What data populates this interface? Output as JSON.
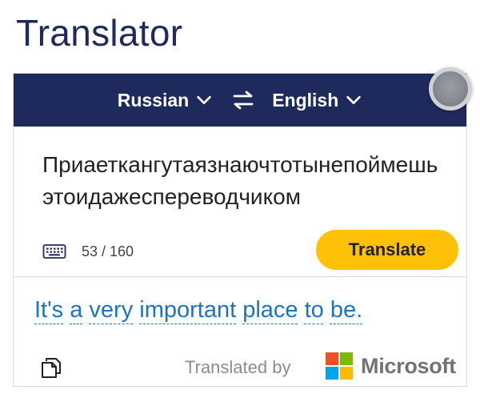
{
  "header": {
    "title": "Translator"
  },
  "languages": {
    "source": "Russian",
    "target": "English"
  },
  "source": {
    "text": "Приаеткангутаязнаючтотынепоймешьэтоидажеспереводчиком",
    "count": "53 / 160"
  },
  "actions": {
    "translate_label": "Translate"
  },
  "result": {
    "words": [
      "It's",
      "a",
      "very",
      "important",
      "place",
      "to",
      "be."
    ]
  },
  "attribution": {
    "translated_by": "Translated by",
    "provider": "Microsoft"
  },
  "colors": {
    "navy": "#1f2a5c",
    "accent": "#ffc107",
    "link": "#1a73c9"
  },
  "icons": {
    "swap": "swap-arrows-icon",
    "keyboard": "keyboard-icon",
    "copy": "copy-icon",
    "logo": "microsoft-logo-icon"
  }
}
